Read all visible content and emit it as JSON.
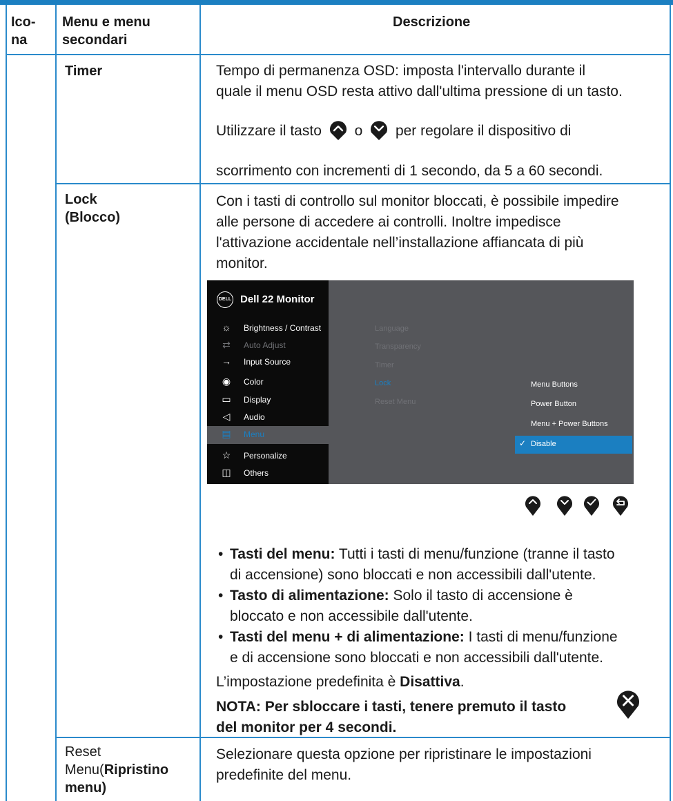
{
  "header": {
    "col_icon": "Ico-na",
    "col_icon_line1": "Ico-",
    "col_icon_line2": "na",
    "col_menu_line1": "Menu e menu",
    "col_menu_line2": "secondari",
    "col_desc": "Descrizione"
  },
  "rows": {
    "timer": {
      "menu": "Timer",
      "desc_p1_line1": "Tempo di permanenza OSD: imposta l'intervallo durante il",
      "desc_p1_line2": "quale il menu OSD resta attivo dall'ultima pressione di un tasto.",
      "desc_p2_pre": "Utilizzare il tasto",
      "desc_p2_mid": "o",
      "desc_p2_post": "per regolare il dispositivo di",
      "desc_p3": "scorrimento con incrementi di 1 secondo, da 5 a 60 secondi."
    },
    "lock": {
      "menu_line1": "Lock",
      "menu_line2": "(Blocco)",
      "desc_p1_line1": "Con i tasti di controllo sul monitor bloccati, è possibile impedire",
      "desc_p1_line2": "alle persone di accedere ai controlli. Inoltre impedisce",
      "desc_p1_line3": "l'attivazione accidentale nell’installazione affiancata di più",
      "desc_p1_line4": "monitor.",
      "bullets": [
        {
          "term": "Tasti del menu:",
          "line1": " Tutti i tasti di menu/funzione (tranne il tasto",
          "line2": "di accensione) sono bloccati e non accessibili dall'utente."
        },
        {
          "term": "Tasto di alimentazione:",
          "line1": " Solo il tasto di accensione è",
          "line2": "bloccato e non accessibile dall'utente."
        },
        {
          "term": "Tasti del menu + di alimentazione:",
          "line1": " I tasti di menu/funzione",
          "line2": "e di accensione sono bloccati e non accessibili dall'utente."
        }
      ],
      "default_pre": "L’impostazione predefinita è ",
      "default_value": "Disattiva",
      "default_post": ".",
      "note_line1": "NOTA: Per sbloccare i tasti, tenere premuto il tasto",
      "note_line2": "del monitor per 4 secondi."
    },
    "reset": {
      "menu_line1": "Reset",
      "menu_line2_plain": "Menu(",
      "menu_line2_bold": "Ripristino",
      "menu_line3": "menu)",
      "desc_line1": "Selezionare questa opzione per ripristinare le impostazioni",
      "desc_line2": "predefinite del menu."
    }
  },
  "osd": {
    "logo": "DELL",
    "title": "Dell 22 Monitor",
    "main_menu": [
      {
        "label": "Brightness / Contrast",
        "icon": "brightness-icon",
        "state": "normal"
      },
      {
        "label": "Auto Adjust",
        "icon": "auto-adjust-icon",
        "state": "dim"
      },
      {
        "label": "Input Source",
        "icon": "input-source-icon",
        "state": "normal"
      },
      {
        "label": "Color",
        "icon": "color-icon",
        "state": "normal"
      },
      {
        "label": "Display",
        "icon": "display-icon",
        "state": "normal"
      },
      {
        "label": "Audio",
        "icon": "audio-icon",
        "state": "normal"
      },
      {
        "label": "Menu",
        "icon": "menu-icon",
        "state": "selected"
      },
      {
        "label": "Personalize",
        "icon": "star-icon",
        "state": "normal"
      },
      {
        "label": "Others",
        "icon": "others-icon",
        "state": "normal"
      }
    ],
    "sub_menu": [
      "Language",
      "Transparency",
      "Timer",
      "Lock",
      "Reset Menu"
    ],
    "options": [
      {
        "label": "Menu Buttons",
        "selected": false
      },
      {
        "label": "Power Button",
        "selected": false
      },
      {
        "label": "Menu + Power Buttons",
        "selected": false
      },
      {
        "label": "Disable",
        "selected": true
      }
    ],
    "nav_buttons": [
      "up-button-icon",
      "down-button-icon",
      "check-button-icon",
      "back-button-icon"
    ]
  },
  "colors": {
    "border": "#2a8acb",
    "accent": "#1b7fc1",
    "osd_bg": "#55565a",
    "osd_panel": "#0b0b0b"
  }
}
